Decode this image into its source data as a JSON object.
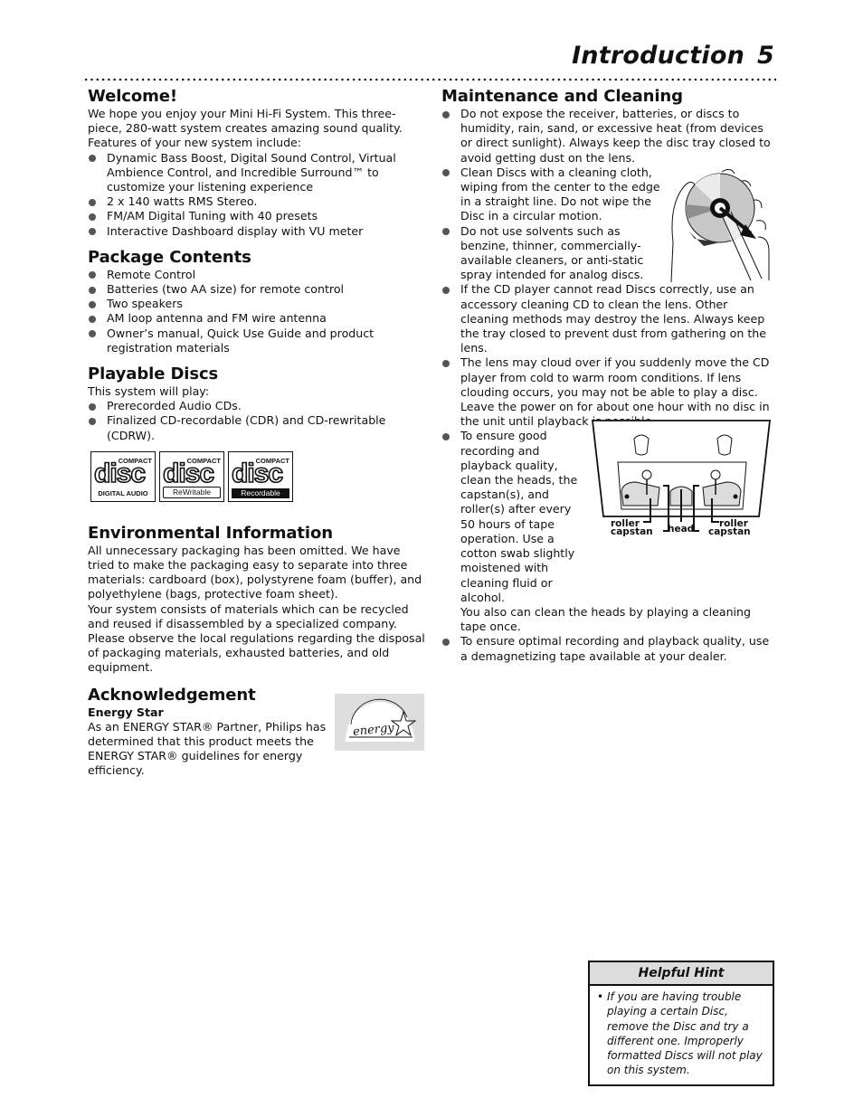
{
  "header": {
    "title": "Introduction",
    "page_number": "5"
  },
  "left": {
    "welcome": {
      "heading": "Welcome!",
      "intro": "We hope you enjoy your Mini Hi-Fi  System. This three-piece, 280-watt system creates amazing sound quality. Features of your new system include:",
      "items": [
        "Dynamic Bass Boost, Digital Sound Control, Virtual Ambience Control, and Incredible Surround™ to customize your listening experience",
        "2 x 140 watts RMS Stereo.",
        "FM/AM Digital Tuning with 40 presets",
        "Interactive Dashboard display with VU meter"
      ]
    },
    "package": {
      "heading": "Package Contents",
      "items": [
        "Remote Control",
        "Batteries (two AA size) for remote control",
        "Two speakers",
        "AM loop antenna and FM wire antenna",
        "Owner’s manual, Quick Use Guide and product registration materials"
      ]
    },
    "discs": {
      "heading": "Playable Discs",
      "intro": "This system will play:",
      "items": [
        "Prerecorded Audio CDs.",
        "Finalized CD-recordable (CDR) and CD-rewritable (CDRW)."
      ],
      "logos": [
        {
          "top": "COMPACT",
          "word": "disc",
          "sub": "DIGITAL AUDIO"
        },
        {
          "top": "COMPACT",
          "word": "disc",
          "sub": "ReWritable"
        },
        {
          "top": "COMPACT",
          "word": "disc",
          "sub": "Recordable"
        }
      ]
    },
    "environment": {
      "heading": "Environmental Information",
      "para1": "All unnecessary packaging has been omitted. We have tried to make the packaging easy to separate into three materials: cardboard (box), polystyrene foam (buffer), and polyethylene (bags, protective foam sheet).",
      "para2": "Your system consists of materials which can be recycled and reused if disassembled by a specialized company. Please observe the local regulations regarding the disposal of packaging materials, exhausted batteries, and old equipment."
    },
    "acknowledgement": {
      "heading": "Acknowledgement",
      "subheading": "Energy Star",
      "text": "As an ENERGY STAR® Partner, Philips has determined that this product meets the ENERGY STAR® guidelines for energy efficiency.",
      "logo_text": "energy"
    }
  },
  "right": {
    "maintenance": {
      "heading": "Maintenance and Cleaning",
      "items": [
        "Do not expose the receiver, batteries, or discs to humidity, rain, sand, or excessive heat (from devices or direct sunlight).  Always keep the disc tray closed to avoid getting dust on the lens.",
        "Clean Discs with a cleaning cloth, wiping from the center to the edge in a straight line. Do not wipe the Disc in a circular motion.",
        "Do not use solvents such as benzine, thinner, commercially-available cleaners, or anti-static spray intended for analog discs.",
        "If the CD player cannot read Discs correctly, use an accessory cleaning CD to clean the lens. Other cleaning methods may destroy the lens. Always keep the tray closed to prevent dust from gathering on the lens.",
        "The lens may cloud over if you suddenly move the CD player from cold to warm room conditions. If lens clouding occurs, you may not be able to play a disc. Leave the power on for about one hour with no disc in the unit until playback is possible",
        "To ensure good recording and playback quality, clean the heads, the capstan(s), and roller(s) after every 50 hours of tape operation. Use a cotton swab slightly moistened with cleaning fluid or alcohol.",
        "To ensure optimal recording and playback quality, use a demagnetizing tape available at your dealer."
      ],
      "tape_extra": "You also can clean the heads by playing a cleaning tape once.",
      "tape_labels": {
        "roller_left": "roller",
        "capstan_left": "capstan",
        "head": "head",
        "roller_right": "roller",
        "capstan_right": "capstan"
      }
    }
  },
  "hint": {
    "title": "Helpful Hint",
    "bullet": "•",
    "text": "If you are having trouble playing a certain Disc, remove the Disc and try a different one. Improperly formatted Discs will not play on this system."
  }
}
